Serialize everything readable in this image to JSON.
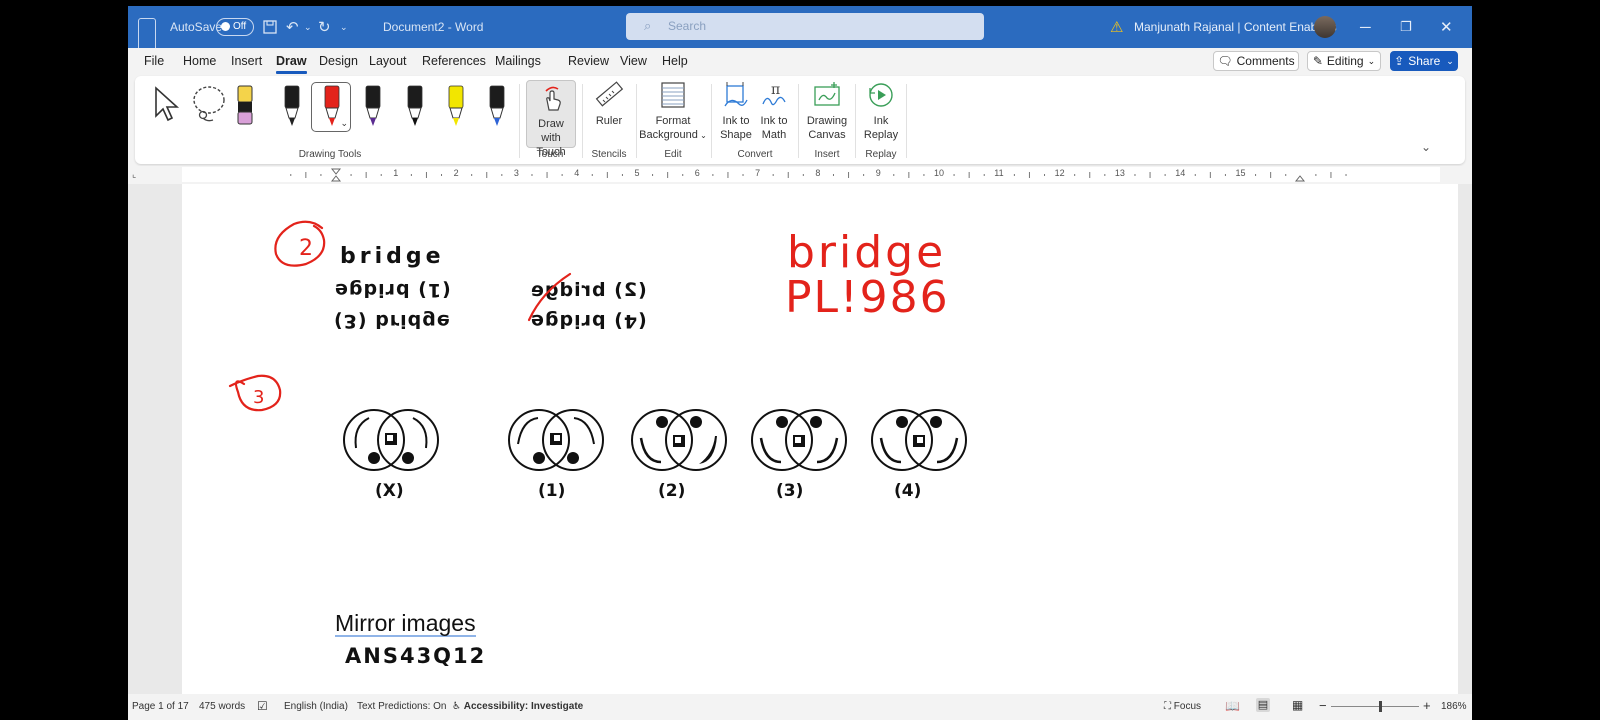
{
  "titlebar": {
    "autosave_label": "AutoSave",
    "autosave_state": "Off",
    "document_name": "Document2  -  Word",
    "search_placeholder": "Search",
    "user_name": "Manjunath Rajanal | Content Enablers"
  },
  "tabs": [
    "File",
    "Home",
    "Insert",
    "Draw",
    "Design",
    "Layout",
    "References",
    "Mailings",
    "Review",
    "View",
    "Help"
  ],
  "active_tab": "Draw",
  "tab_actions": {
    "comments": "Comments",
    "editing": "Editing",
    "share": "Share"
  },
  "ribbon": {
    "groups": {
      "drawing_tools": "Drawing Tools",
      "touch": "Touch",
      "stencils": "Stencils",
      "edit": "Edit",
      "convert": "Convert",
      "insert": "Insert",
      "replay": "Replay"
    },
    "buttons": {
      "draw_with_touch_1": "Draw with",
      "draw_with_touch_2": "Touch",
      "ruler": "Ruler",
      "format_bg_1": "Format",
      "format_bg_2": "Background",
      "ink_shape_1": "Ink to",
      "ink_shape_2": "Shape",
      "ink_math_1": "Ink to",
      "ink_math_2": "Math",
      "drawing_canvas_1": "Drawing",
      "drawing_canvas_2": "Canvas",
      "ink_replay_1": "Ink",
      "ink_replay_2": "Replay"
    },
    "pens": [
      {
        "name": "pencil-pen",
        "color": "#222222"
      },
      {
        "name": "red-pen",
        "color": "#e3231b"
      },
      {
        "name": "purple-pen",
        "color": "#5b2c91"
      },
      {
        "name": "black-marker",
        "color": "#111111"
      },
      {
        "name": "yellow-highlighter",
        "color": "#f2e600"
      },
      {
        "name": "galaxy-pen",
        "color": "#2e63d6"
      }
    ]
  },
  "ruler": {
    "numbers": [
      "1",
      "2",
      "3",
      "4",
      "5",
      "6",
      "7",
      "8",
      "9",
      "10",
      "11",
      "12",
      "13",
      "14",
      "15"
    ]
  },
  "document": {
    "question_word": "bridge",
    "options": {
      "opt1": "(1) bridge",
      "opt2": "(2) bridge",
      "opt3": "(3) bridge",
      "opt4": "(4) bridge"
    },
    "handwritten": {
      "q2_number": "2",
      "q3_number": "3",
      "answer_word": "bridge",
      "answer_mirror": "PL!986"
    },
    "figure_labels": [
      "(X)",
      "(1)",
      "(2)",
      "(3)",
      "(4)"
    ],
    "mirror_title": "Mirror  images",
    "answer_code": "ANS43Q12"
  },
  "statusbar": {
    "page": "Page 1 of 17",
    "words": "475 words",
    "language": "English (India)",
    "text_predictions": "Text Predictions: On",
    "accessibility": "Accessibility: Investigate",
    "focus": "Focus",
    "zoom": "186%"
  },
  "colors": {
    "accent": "#185abd",
    "titlebar": "#2b6bbf",
    "ink": "#e3231b"
  }
}
